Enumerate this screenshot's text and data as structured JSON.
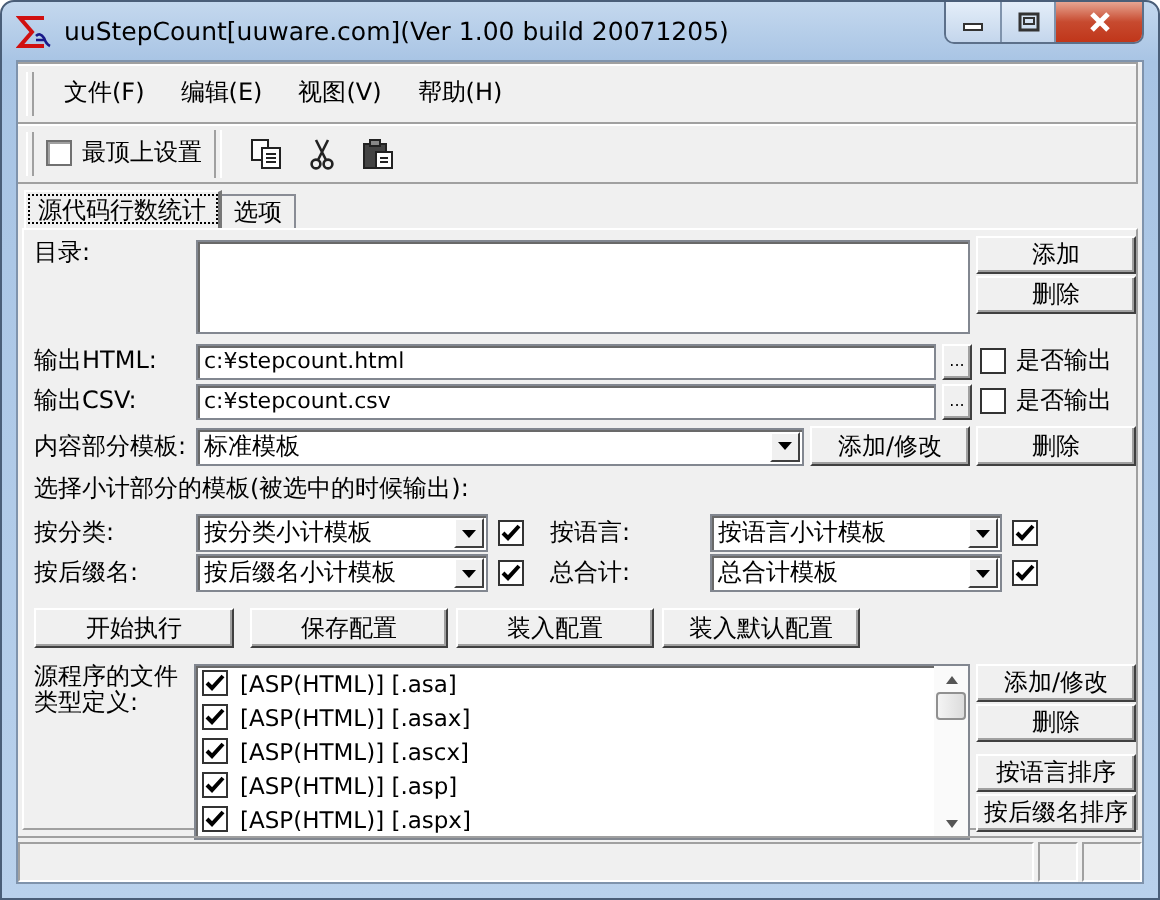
{
  "window": {
    "title": "uuStepCount[uuware.com](Ver 1.00 build 20071205)"
  },
  "menu": [
    "文件(F)",
    "编辑(E)",
    "视图(V)",
    "帮助(H)"
  ],
  "toolbar": {
    "always_on_top": {
      "label": "最顶上设置",
      "checked": false
    }
  },
  "tabs": [
    {
      "label": "源代码行数统计",
      "selected": true
    },
    {
      "label": "选项",
      "selected": false
    }
  ],
  "directory": {
    "label": "目录:",
    "buttons": [
      "添加",
      "删除"
    ]
  },
  "outputs": [
    {
      "label": "输出HTML:",
      "value": "c:¥stepcount.html",
      "browse": "...",
      "output": {
        "label": "是否输出",
        "checked": false
      }
    },
    {
      "label": "输出CSV:",
      "value": "c:¥stepcount.csv",
      "browse": "...",
      "output": {
        "label": "是否输出",
        "checked": false
      }
    }
  ],
  "content_template": {
    "label": "内容部分模板:",
    "value": "标准模板",
    "buttons": [
      "添加/修改",
      "删除"
    ]
  },
  "subtotal_heading": "选择小计部分的模板(被选中的时候输出):",
  "subtotals": [
    {
      "label": "按分类:",
      "value": "按分类小计模板",
      "checked": true
    },
    {
      "label": "按语言:",
      "value": "按语言小计模板",
      "checked": true
    },
    {
      "label": "按后缀名:",
      "value": "按后缀名小计模板",
      "checked": true
    },
    {
      "label": "总合计:",
      "value": "总合计模板",
      "checked": true
    }
  ],
  "actions": [
    "开始执行",
    "保存配置",
    "装入配置",
    "装入默认配置"
  ],
  "file_types": {
    "label": "源程序的文件类型定义:",
    "items": [
      {
        "label": "[ASP(HTML)] [.asa]",
        "checked": true
      },
      {
        "label": "[ASP(HTML)] [.asax]",
        "checked": true
      },
      {
        "label": "[ASP(HTML)] [.ascx]",
        "checked": true
      },
      {
        "label": "[ASP(HTML)] [.asp]",
        "checked": true
      },
      {
        "label": "[ASP(HTML)] [.aspx]",
        "checked": true
      }
    ],
    "buttons": [
      "添加/修改",
      "删除",
      "按语言排序",
      "按后缀名排序"
    ]
  }
}
